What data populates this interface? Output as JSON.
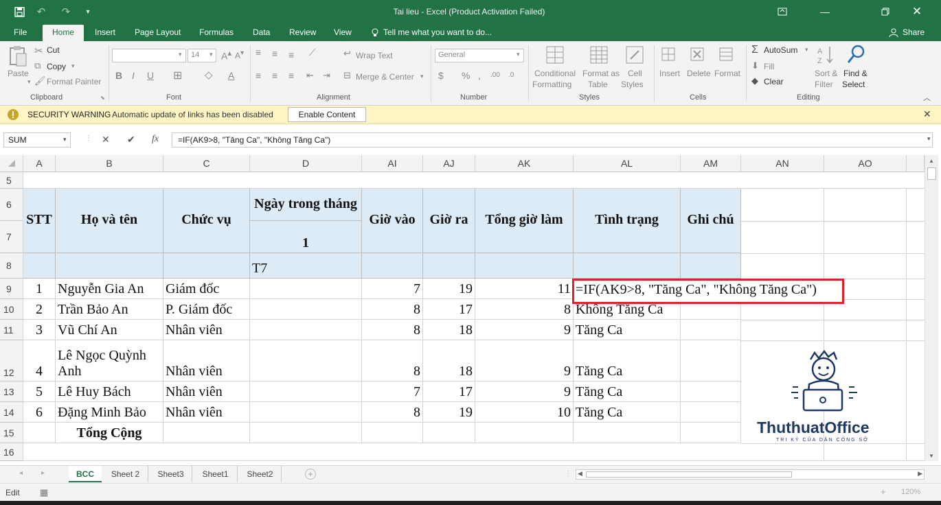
{
  "window": {
    "title": "Tai lieu - Excel (Product Activation Failed)"
  },
  "ribbon_tabs": [
    "File",
    "Home",
    "Insert",
    "Page Layout",
    "Formulas",
    "Data",
    "Review",
    "View"
  ],
  "tell_me": "Tell me what you want to do...",
  "share": "Share",
  "clipboard": {
    "paste": "Paste",
    "cut": "Cut",
    "copy": "Copy",
    "format_painter": "Format Painter",
    "group": "Clipboard"
  },
  "font": {
    "name": "",
    "size": "14",
    "group": "Font"
  },
  "alignment": {
    "wrap": "Wrap Text",
    "merge": "Merge & Center",
    "group": "Alignment"
  },
  "number": {
    "format": "General",
    "group": "Number"
  },
  "styles": {
    "conditional": [
      "Conditional",
      "Formatting"
    ],
    "format_table": [
      "Format as",
      "Table"
    ],
    "cell_styles": [
      "Cell",
      "Styles"
    ],
    "group": "Styles"
  },
  "cells": {
    "insert": "Insert",
    "delete": "Delete",
    "format": "Format",
    "group": "Cells"
  },
  "editing": {
    "autosum": "AutoSum",
    "fill": "Fill",
    "clear": "Clear",
    "sort": [
      "Sort &",
      "Filter"
    ],
    "find": [
      "Find &",
      "Select"
    ],
    "group": "Editing"
  },
  "security": {
    "label": "SECURITY WARNING",
    "message": "Automatic update of links has been disabled",
    "button": "Enable Content"
  },
  "formula_bar": {
    "name_box": "SUM",
    "formula": "=IF(AK9>8, \"Tăng Ca\", \"Không Tăng Ca\")"
  },
  "columns": [
    "A",
    "B",
    "C",
    "D",
    "AI",
    "AJ",
    "AK",
    "AL",
    "AM",
    "AN",
    "AO"
  ],
  "rows": [
    "5",
    "6",
    "7",
    "8",
    "9",
    "10",
    "11",
    "12",
    "13",
    "14",
    "15",
    "16"
  ],
  "table": {
    "headers": {
      "stt": "STT",
      "name": "Họ và tên",
      "role": "Chức vụ",
      "day": "Ngày trong tháng",
      "day_num": "1",
      "time_in": "Giờ vào",
      "time_out": "Giờ ra",
      "total": "Tổng giờ làm",
      "status": "Tình trạng",
      "note": "Ghi chú",
      "weekday": "T7"
    },
    "rows": [
      {
        "stt": "1",
        "name": "Nguyễn Gia An",
        "role": "Giám đốc",
        "in": "7",
        "out": "19",
        "total": "11",
        "status": "=IF(AK9>8, \"Tăng Ca\", \"Không Tăng Ca\")"
      },
      {
        "stt": "2",
        "name": "Trần Bảo An",
        "role": "P. Giám đốc",
        "in": "8",
        "out": "17",
        "total": "8",
        "status": "Không Tăng Ca"
      },
      {
        "stt": "3",
        "name": "Vũ Chí An",
        "role": "Nhân viên",
        "in": "8",
        "out": "18",
        "total": "9",
        "status": "Tăng Ca"
      },
      {
        "stt": "4",
        "name1": "Lê Ngọc Quỳnh",
        "name2": "Anh",
        "role": "Nhân viên",
        "in": "8",
        "out": "18",
        "total": "9",
        "status": "Tăng Ca"
      },
      {
        "stt": "5",
        "name": "Lê Huy Bách",
        "role": "Nhân viên",
        "in": "7",
        "out": "17",
        "total": "9",
        "status": "Tăng Ca"
      },
      {
        "stt": "6",
        "name": "Đặng Minh Bảo",
        "role": "Nhân viên",
        "in": "8",
        "out": "19",
        "total": "10",
        "status": "Tăng Ca"
      }
    ],
    "footer": "Tổng Cộng"
  },
  "watermark": {
    "brand": "ThuthuatOffice",
    "tagline": "TRI KỶ CỦA DÂN CÔNG SỞ"
  },
  "sheets": [
    "BCC",
    "Sheet 2",
    "Sheet3",
    "Sheet1",
    "Sheet2"
  ],
  "status": {
    "mode": "Edit",
    "zoom": "120%"
  },
  "colors": {
    "excel_green": "#217346",
    "header_blue": "#ddebf7",
    "highlight_red": "#e0212a"
  }
}
